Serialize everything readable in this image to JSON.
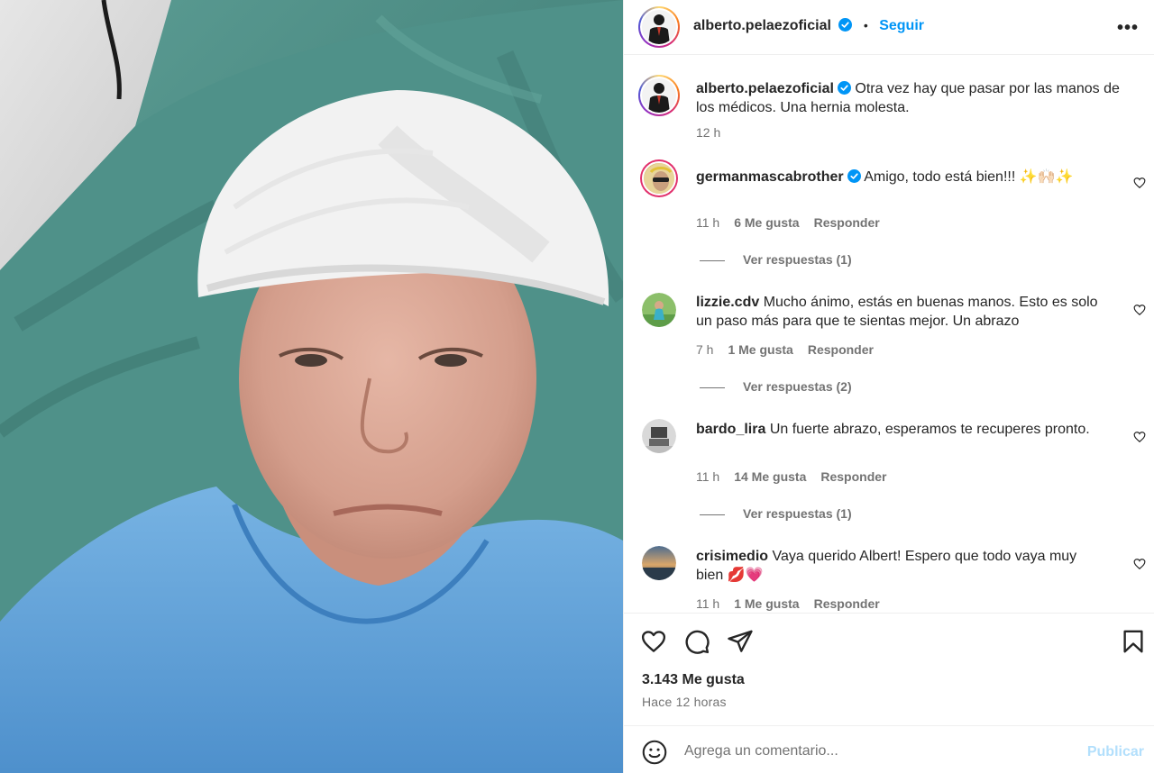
{
  "post": {
    "author": "alberto.pelaezoficial",
    "follow_label": "Seguir",
    "more_label": "•••",
    "caption": "Otra vez hay que pasar por las manos de los médicos. Una hernia molesta.",
    "caption_time": "12 h"
  },
  "comments": [
    {
      "username": "germanmascabrother",
      "verified": true,
      "text": "Amigo, todo está bien!!! ✨🙌🏻✨",
      "time": "11 h",
      "likes": "6 Me gusta",
      "reply_label": "Responder",
      "view_replies": "Ver respuestas (1)"
    },
    {
      "username": "lizzie.cdv",
      "verified": false,
      "text": "Mucho ánimo, estás en buenas manos. Esto es solo un paso más para que te sientas mejor. Un abrazo",
      "time": "7 h",
      "likes": "1 Me gusta",
      "reply_label": "Responder",
      "view_replies": "Ver respuestas (2)"
    },
    {
      "username": "bardo_lira",
      "verified": false,
      "text": "Un fuerte abrazo, esperamos te recuperes pronto.",
      "time": "11 h",
      "likes": "14 Me gusta",
      "reply_label": "Responder",
      "view_replies": "Ver respuestas (1)"
    },
    {
      "username": "crisimedio",
      "verified": false,
      "text": "Vaya querido Albert! Espero que todo vaya muy bien 💋💗",
      "time": "11 h",
      "likes": "1 Me gusta",
      "reply_label": "Responder"
    }
  ],
  "actions": {
    "like_icon": "heart-icon",
    "comment_icon": "comment-icon",
    "share_icon": "share-icon",
    "save_icon": "bookmark-icon"
  },
  "stats": {
    "likes": "3.143 Me gusta",
    "posted": "Hace 12 horas"
  },
  "composer": {
    "placeholder": "Agrega un comentario...",
    "publish_label": "Publicar"
  },
  "colors": {
    "accent": "#0095f6",
    "publish_disabled": "#b2dffc",
    "muted_text": "#737373",
    "verified_badge": "#0095f6"
  }
}
